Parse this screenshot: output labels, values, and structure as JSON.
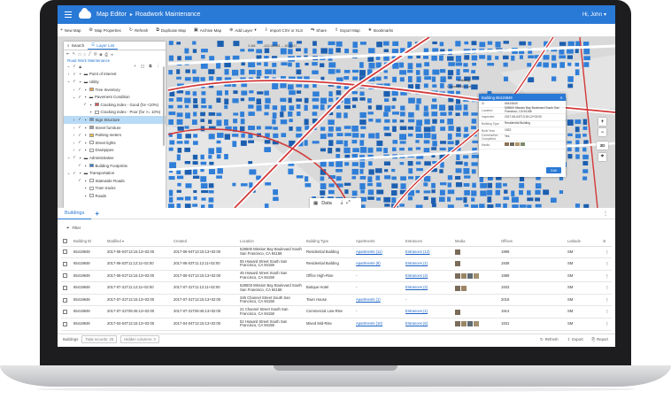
{
  "app": {
    "title": "Map Editor",
    "project": "Roadwork Maintenance",
    "user": "Hi, John",
    "brand_color": "#2979d6"
  },
  "toolbar": [
    {
      "icon": "plus-icon",
      "label": "New Map"
    },
    {
      "icon": "gear-icon",
      "label": "Map Properties"
    },
    {
      "icon": "refresh-icon",
      "label": "Refresh"
    },
    {
      "icon": "duplicate-icon",
      "label": "Duplicate Map"
    },
    {
      "icon": "archive-icon",
      "label": "Archive Map"
    },
    {
      "icon": "add-layer-icon",
      "label": "Add Layer"
    },
    {
      "icon": "import-icon",
      "label": "Import CSV or XLS"
    },
    {
      "icon": "share-icon",
      "label": "Share"
    },
    {
      "icon": "export-icon",
      "label": "Export Map"
    },
    {
      "icon": "bookmark-icon",
      "label": "Bookmarks"
    }
  ],
  "map": {
    "scale": "1:1M",
    "coordinates": "-122.42043 ... 40.5917 ...",
    "labels": [
      "Building",
      "Cannery District"
    ],
    "controls": {
      "zoom_in": "+",
      "zoom_out": "−",
      "view_3d": "3D"
    },
    "data_tab": "Data"
  },
  "layer_panel": {
    "search_label": "Search",
    "list_label": "Layer List",
    "map_name": "Road Work Maintenance",
    "layers": [
      {
        "label": "Point of interest",
        "expand": "›",
        "checked": true,
        "type": "folder"
      },
      {
        "label": "Utility",
        "expand": "⌄",
        "checked": true,
        "type": "folder"
      },
      {
        "label": "Tree Inventory",
        "expand": "›",
        "checked": true,
        "type": "layer",
        "indent": 1,
        "swatch": "#f4a24a"
      },
      {
        "label": "Pavement Condition",
        "expand": "⌄",
        "checked": true,
        "type": "folder",
        "indent": 1
      },
      {
        "label": "Cracking index - Good (for <10%)",
        "expand": "",
        "checked": true,
        "type": "layer",
        "indent": 2,
        "swatch": "#d9534f"
      },
      {
        "label": "Cracking index - Poor (for >= 10%)",
        "expand": "",
        "checked": false,
        "type": "layer",
        "indent": 2,
        "swatch": "#ffffff"
      },
      {
        "label": "Sign Structure",
        "expand": "›",
        "checked": true,
        "type": "layer",
        "indent": 1,
        "swatch": "#5b9bd5",
        "selected": true
      },
      {
        "label": "Street furniture",
        "expand": "›",
        "checked": true,
        "type": "layer",
        "indent": 1,
        "swatch": "#9e9e9e"
      },
      {
        "label": "Parking meters",
        "expand": "›",
        "checked": true,
        "type": "layer",
        "indent": 1,
        "swatch": "#f0c040"
      },
      {
        "label": "Street lights",
        "expand": "›",
        "checked": true,
        "type": "layer",
        "indent": 1,
        "swatch": "#ffffff"
      },
      {
        "label": "Drainpipes",
        "expand": "›",
        "checked": true,
        "type": "layer",
        "indent": 1,
        "swatch": "#ffffff"
      },
      {
        "label": "Administrative",
        "expand": "⌄",
        "checked": true,
        "type": "folder"
      },
      {
        "label": "Building Footprints",
        "expand": "",
        "checked": true,
        "type": "layer",
        "indent": 1,
        "swatch": "#2f7ed8"
      },
      {
        "label": "Transportation",
        "expand": "⌄",
        "checked": true,
        "type": "folder"
      },
      {
        "label": "Statewide Roads",
        "expand": "",
        "checked": true,
        "type": "layer",
        "indent": 1,
        "swatch": "#ffffff"
      },
      {
        "label": "Tram tracks",
        "expand": "",
        "checked": false,
        "type": "layer",
        "indent": 1,
        "swatch": "#ffffff"
      },
      {
        "label": "Roads",
        "expand": "",
        "checked": false,
        "type": "layer",
        "indent": 1,
        "swatch": "#ffffff"
      }
    ]
  },
  "popup": {
    "title": "Building 65419849",
    "rows": [
      {
        "k": "ID",
        "v": "65419849"
      },
      {
        "k": "Location",
        "v": "528500 Mission Bay Boulevard South San Francisco, CA 94158"
      },
      {
        "k": "Inspected",
        "v": "2017-06-04T13:15:12+02:00"
      },
      {
        "k": "Building Type",
        "v": "Residential Building"
      },
      {
        "k": "Build Year",
        "v": "1922"
      },
      {
        "k": "Construction Completed",
        "v": "Yes"
      },
      {
        "k": "Media",
        "v": ""
      }
    ],
    "save_label": "Edit"
  },
  "bottom": {
    "tab": "Buildings",
    "filter_label": "Filter",
    "columns": [
      "Building ID",
      "Modified",
      "Created",
      "Location",
      "Building Type",
      "Apartments",
      "Entrances",
      "Media",
      "Offices",
      "Latitude"
    ],
    "rows": [
      {
        "id": "65419849",
        "modified": "2017-06-04T13:15:13+02:00",
        "created": "2017-06-04T13:15:13+02:00",
        "location": "528500 Mission Bay Boulevard South San Francisco, CA 94158",
        "type": "Residential Building",
        "apartments": "Apartments (11)",
        "entrances": "Entrances (12)",
        "media": 1,
        "offices": "1999",
        "lat": "SM"
      },
      {
        "id": "65419849",
        "modified": "2017-06-03T11:12:11+02:00",
        "created": "2017-06-03T11:12:11+02:00",
        "location": "55 Howard Street South San Francisco, CA 94158",
        "type": "Residential Building",
        "apartments": "Apartments (8)",
        "entrances": "Entrances (1)",
        "media": 1,
        "offices": "1939",
        "lat": "SM"
      },
      {
        "id": "65419849",
        "modified": "2017-06-01T13:15:13+02:00",
        "created": "2017-06-01T13:15:13+02:00",
        "location": "45 Howard Street South San Francisco, CA 94158",
        "type": "Office High-Rise",
        "apartments": "-",
        "entrances": "Entrances (4)",
        "media": 4,
        "offices": "1989",
        "lat": "SM"
      },
      {
        "id": "65419849",
        "modified": "2017-07-31T11:12:11+02:00",
        "created": "2017-07-31T11:12:11+02:00",
        "location": "528503 Mission Bay Boulevard South San Francisco, CA 94158",
        "type": "Butique Hotel",
        "apartments": "-",
        "entrances": "Entrances (2)",
        "media": 2,
        "offices": "1933",
        "lat": "SM"
      },
      {
        "id": "65419849",
        "modified": "2017-07-31T13:15:13+02:00",
        "created": "2017-07-31T13:15:13+02:00",
        "location": "345 Channel Street South San Francisco, CA 94158",
        "type": "Town House",
        "apartments": "Apartments (1)",
        "entrances": "-",
        "media": 0,
        "offices": "2018",
        "lat": "SM"
      },
      {
        "id": "65419849",
        "modified": "2017-07-31T09:45:13+02:00",
        "created": "2017-07-31T09:45:13+02:00",
        "location": "21 Channel Street South San Francisco, CA 94158",
        "type": "Commercial Low-Rise",
        "apartments": "-",
        "entrances": "Entrances (1)",
        "media": 1,
        "offices": "1914",
        "lat": "SM"
      },
      {
        "id": "65419849",
        "modified": "2017-04-04T13:15:13+02:00",
        "created": "2017-04-04T13:15:13+02:00",
        "location": "52 Howard Street South San Francisco, CA 94158",
        "type": "Mixed Mid-Rise",
        "apartments": "Apartments (10)",
        "entrances": "Entrances (6)",
        "media": 4,
        "offices": "1931",
        "lat": "SM"
      }
    ],
    "footer": {
      "label": "Buildings",
      "total": "Total records: 25",
      "hidden": "Hidden columns: 3",
      "refresh": "Refresh",
      "export": "Export",
      "report": "Report"
    }
  }
}
